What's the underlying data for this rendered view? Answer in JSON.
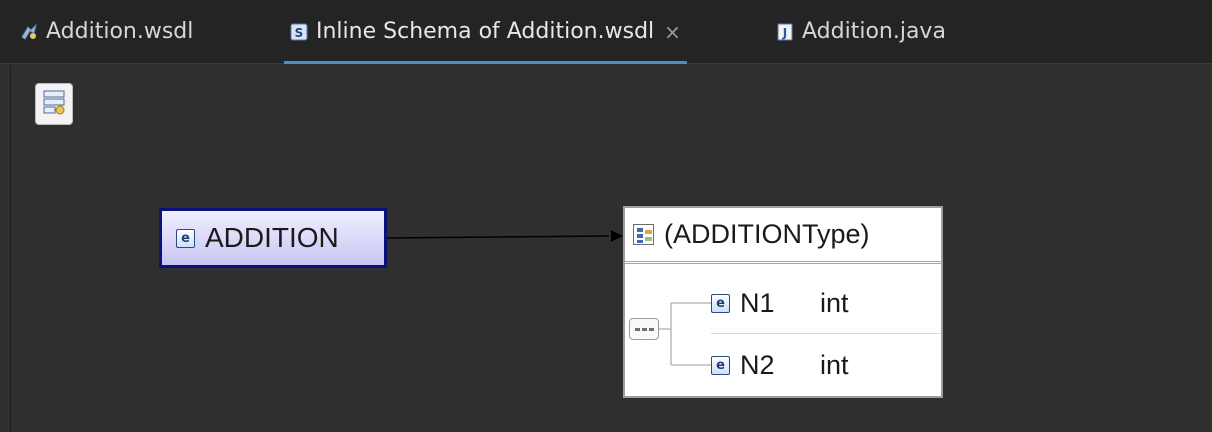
{
  "tabs": [
    {
      "label": "Addition.wsdl",
      "icon": "wsdl-file-icon",
      "active": false,
      "closable": false
    },
    {
      "label": "Inline Schema of Addition.wsdl",
      "icon": "schema-file-icon",
      "active": true,
      "closable": true,
      "close_glyph": "×"
    },
    {
      "label": "Addition.java",
      "icon": "java-file-icon",
      "active": false,
      "closable": false
    }
  ],
  "toolbar": {
    "icon": "schema-overview-icon"
  },
  "element": {
    "label": "ADDITION",
    "icon": "element-icon",
    "icon_glyph": "e"
  },
  "type": {
    "label": "(ADDITIONType)",
    "icon": "complex-type-icon",
    "compositor_icon": "sequence-icon",
    "fields": [
      {
        "name": "N1",
        "type": "int",
        "icon_glyph": "e"
      },
      {
        "name": "N2",
        "type": "int",
        "icon_glyph": "e"
      }
    ]
  },
  "colors": {
    "background": "#2f2f2f",
    "tab_active_underline": "#4a90c8",
    "element_border": "#0a127a",
    "element_fill": "#c9c6f2"
  }
}
